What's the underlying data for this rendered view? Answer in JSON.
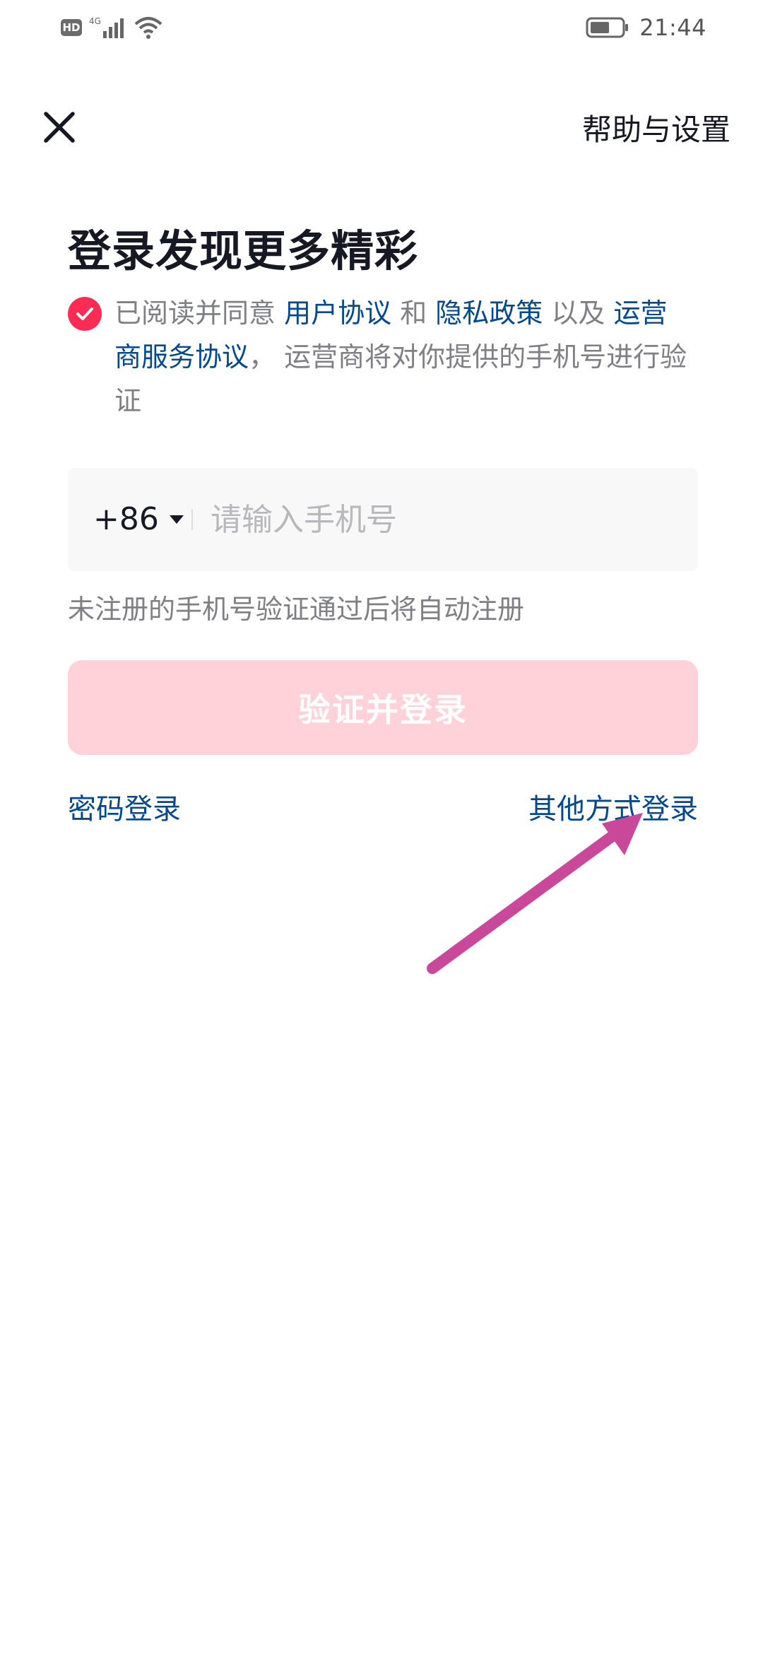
{
  "status_bar": {
    "hd_label": "HD",
    "network_label": "4G",
    "time": "21:44",
    "icons": [
      "hd-icon",
      "signal-icon",
      "wifi-icon",
      "battery-icon"
    ]
  },
  "header": {
    "close_icon": "close-icon",
    "help_settings": "帮助与设置"
  },
  "title": "登录发现更多精彩",
  "agreement": {
    "checked": true,
    "prefix": "已阅读并同意 ",
    "user_agreement": "用户协议",
    "and": " 和 ",
    "privacy_policy": "隐私政策",
    "also": " 以及 ",
    "carrier_agreement": "运营商服务协议",
    "suffix": "， 运营商将对你提供的手机号进行验证"
  },
  "phone": {
    "country_code": "+86",
    "value": "",
    "placeholder": "请输入手机号"
  },
  "hint": "未注册的手机号验证通过后将自动注册",
  "submit_label": "验证并登录",
  "password_login": "密码登录",
  "other_login": "其他方式登录",
  "colors": {
    "accent": "#fe2c55",
    "link": "#04498d",
    "button_disabled": "#ffd1d9",
    "annotation_arrow": "#c94899"
  }
}
